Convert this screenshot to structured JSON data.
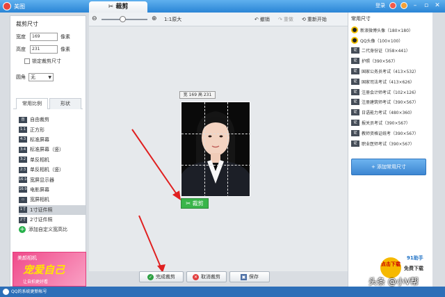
{
  "titlebar": {
    "app_name": "美图",
    "active_tab": "裁剪",
    "login_label": "登录"
  },
  "left_panel": {
    "title": "裁剪尺寸",
    "width_label": "宽度",
    "width_value": "169",
    "height_label": "高度",
    "height_value": "231",
    "unit": "像素",
    "lock_label": "锁定裁剪尺寸",
    "corner_label": "圆角",
    "corner_value": "无",
    "tabs": [
      "常用比例",
      "形状"
    ],
    "ratio_items": [
      {
        "icon": "自",
        "label": "自由裁剪"
      },
      {
        "icon": "1:1",
        "label": "正方形"
      },
      {
        "icon": "4:3",
        "label": "标准屏幕"
      },
      {
        "icon": "3:4",
        "label": "标准屏幕（竖）"
      },
      {
        "icon": "3:2",
        "label": "单反相机"
      },
      {
        "icon": "2:3",
        "label": "单反相机（竖）"
      },
      {
        "icon": "16:10",
        "label": "宽屏显示器"
      },
      {
        "icon": "16:9",
        "label": "电影屏幕"
      },
      {
        "icon": "▭",
        "label": "宽屏相机"
      },
      {
        "icon": "1寸",
        "label": "1寸证件照"
      },
      {
        "icon": "2寸",
        "label": "2寸证件照"
      },
      {
        "icon": "+",
        "label": "添加自定义宽高比"
      }
    ]
  },
  "ad_left": {
    "brand": "美颜相机",
    "title": "宠爱自己",
    "subtitle": "让自拍更好看"
  },
  "toolbar": {
    "zoom_out": "⊖",
    "zoom_in": "⊕",
    "original_size": "1:1原大",
    "undo": "撤销",
    "redo": "重做",
    "restart": "重新开始"
  },
  "canvas": {
    "size_label": "宽 169 高 231",
    "crop_button": "裁剪"
  },
  "bottom": {
    "finish": "完成裁剪",
    "cancel": "取消裁剪",
    "save": "保存"
  },
  "right_panel": {
    "title": "常用尺寸",
    "sizes": [
      {
        "icon": "qq",
        "label": "新浪微博头像（180×180）"
      },
      {
        "icon": "qq",
        "label": "QQ头像（100×100）"
      },
      {
        "icon": "证",
        "label": "二代身份证（358×441）"
      },
      {
        "icon": "证",
        "label": "护照（390×567）"
      },
      {
        "icon": "证",
        "label": "国家公务员考试（413×532）"
      },
      {
        "icon": "证",
        "label": "国家司法考试（413×626）"
      },
      {
        "icon": "证",
        "label": "注册会计师考试（102×126）"
      },
      {
        "icon": "证",
        "label": "注册建筑师考试（390×567）"
      },
      {
        "icon": "证",
        "label": "日语能力考试（480×360）"
      },
      {
        "icon": "证",
        "label": "报关员考试（390×567）"
      },
      {
        "icon": "证",
        "label": "教师资格证统考（390×567）"
      },
      {
        "icon": "证",
        "label": "职业医师考试（390×567）"
      }
    ],
    "add_button": "+ 添加常用尺寸"
  },
  "ad_right": {
    "brand": "91助手",
    "circle_text": "点击下载",
    "text": "免费下载"
  },
  "statusbar": {
    "text": "QQ的系统更新帐号"
  },
  "watermark": "头条 @小V帮"
}
